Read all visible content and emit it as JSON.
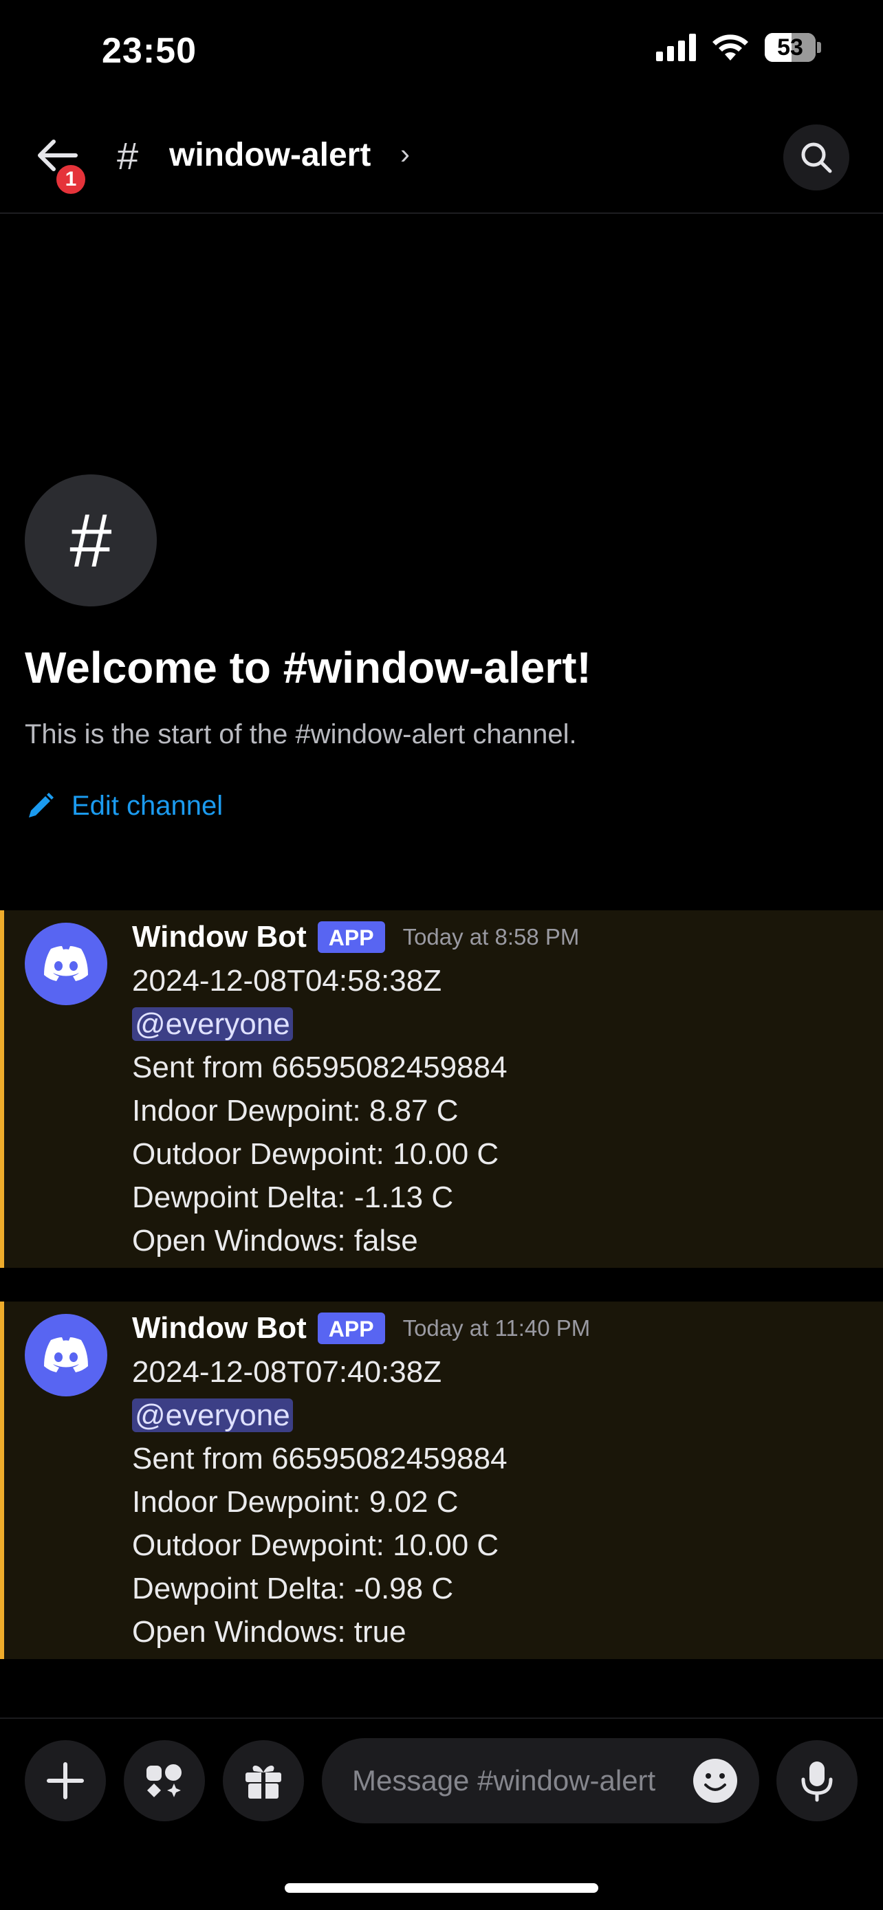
{
  "status_bar": {
    "time": "23:50",
    "battery": "53",
    "battery_level": 0.53
  },
  "header": {
    "back_badge": "1",
    "hash": "#",
    "channel_name": "window-alert",
    "chevron": "›"
  },
  "welcome": {
    "hash": "#",
    "title": "Welcome to #window-alert!",
    "subtitle": "This is the start of the #window-alert channel.",
    "edit_label": "Edit channel"
  },
  "messages": [
    {
      "author": "Window Bot",
      "tag": "APP",
      "timestamp": "Today at 8:58 PM",
      "lines": [
        "2024-12-08T04:58:38Z",
        "@everyone",
        "Sent from 66595082459884",
        "Indoor Dewpoint: 8.87 C",
        "Outdoor Dewpoint: 10.00 C",
        "Dewpoint Delta: -1.13 C",
        "Open Windows: false"
      ]
    },
    {
      "author": "Window Bot",
      "tag": "APP",
      "timestamp": "Today at 11:40 PM",
      "lines": [
        "2024-12-08T07:40:38Z",
        "@everyone",
        "Sent from 66595082459884",
        "Indoor Dewpoint: 9.02 C",
        "Outdoor Dewpoint: 10.00 C",
        "Dewpoint Delta: -0.98 C",
        "Open Windows: true"
      ]
    }
  ],
  "composer": {
    "placeholder": "Message #window-alert"
  },
  "colors": {
    "accent": "#5865f2",
    "link": "#1b9bf0",
    "highlight_border": "#efac2b",
    "highlight_bg": "#1a1609",
    "badge": "#e5333a"
  }
}
